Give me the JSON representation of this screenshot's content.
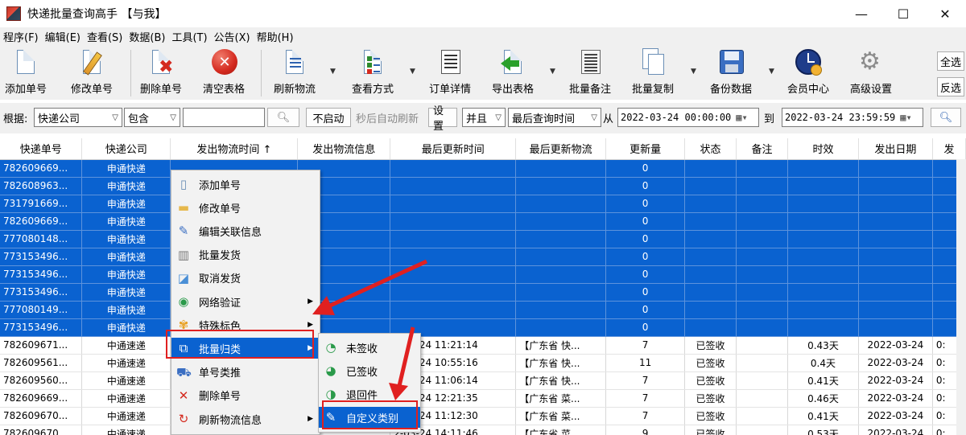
{
  "window": {
    "title": "快递批量查询高手 【与我】",
    "controls": [
      "—",
      "☐",
      "✕"
    ]
  },
  "menu": [
    "程序(F)",
    "编辑(E)",
    "查看(S)",
    "数据(B)",
    "工具(T)",
    "公告(X)",
    "帮助(H)"
  ],
  "toolbar": {
    "buttons": [
      {
        "label": "添加单号",
        "icon": "add-document-icon"
      },
      {
        "label": "修改单号",
        "icon": "edit-pencil-icon"
      },
      {
        "label": "删除单号",
        "icon": "delete-document-icon"
      },
      {
        "label": "清空表格",
        "icon": "clear-red-x-icon"
      },
      {
        "label": "刷新物流",
        "icon": "refresh-document-icon"
      },
      {
        "label": "查看方式",
        "icon": "checklist-icon"
      },
      {
        "label": "订单详情",
        "icon": "order-detail-icon"
      },
      {
        "label": "导出表格",
        "icon": "export-arrow-icon"
      },
      {
        "label": "批量备注",
        "icon": "notes-icon"
      },
      {
        "label": "批量复制",
        "icon": "copy-documents-icon"
      },
      {
        "label": "备份数据",
        "icon": "floppy-disk-icon"
      },
      {
        "label": "会员中心",
        "icon": "clock-member-icon"
      },
      {
        "label": "高级设置",
        "icon": "gear-icon"
      }
    ],
    "select_all": "全选",
    "invert_select": "反选"
  },
  "filter": {
    "basis_label": "根据:",
    "field": "快递公司",
    "operator": "包含",
    "keyword": "",
    "no_start": "不启动",
    "auto_refresh_hint": "秒后自动刷新",
    "settings": "设置",
    "logic": "并且",
    "time_field": "最后查询时间",
    "from_label": "从",
    "from": "2022-03-24 00:00:00",
    "to_label": "到",
    "to": "2022-03-24 23:59:59"
  },
  "table": {
    "columns": [
      "快递单号",
      "快递公司",
      "发出物流时间 ↑",
      "发出物流信息",
      "最后更新时间",
      "最后更新物流",
      "更新量",
      "状态",
      "备注",
      "时效",
      "发出日期",
      "发"
    ],
    "rows": [
      [
        "782609669...",
        "申通快递",
        "",
        "",
        "",
        "",
        "0",
        "",
        "",
        "",
        "",
        ""
      ],
      [
        "782608963...",
        "申通快递",
        "",
        "",
        "",
        "",
        "0",
        "",
        "",
        "",
        "",
        ""
      ],
      [
        "731791669...",
        "申通快递",
        "",
        "",
        "",
        "",
        "0",
        "",
        "",
        "",
        "",
        ""
      ],
      [
        "782609669...",
        "申通快递",
        "",
        "",
        "",
        "",
        "0",
        "",
        "",
        "",
        "",
        ""
      ],
      [
        "777080148...",
        "申通快递",
        "",
        "",
        "",
        "",
        "0",
        "",
        "",
        "",
        "",
        ""
      ],
      [
        "773153496...",
        "申通快递",
        "",
        "",
        "",
        "",
        "0",
        "",
        "",
        "",
        "",
        ""
      ],
      [
        "773153496...",
        "申通快递",
        "",
        "",
        "",
        "",
        "0",
        "",
        "",
        "",
        "",
        ""
      ],
      [
        "773153496...",
        "申通快递",
        "",
        "",
        "",
        "",
        "0",
        "",
        "",
        "",
        "",
        ""
      ],
      [
        "777080149...",
        "申通快递",
        "",
        "",
        "",
        "",
        "0",
        "",
        "",
        "",
        "",
        ""
      ],
      [
        "773153496...",
        "申通快递",
        "",
        "",
        "",
        "",
        "0",
        "",
        "",
        "",
        "",
        ""
      ],
      [
        "782609671...",
        "中通速递",
        "",
        "",
        "2-03-24 11:21:14",
        "【广东省 快...",
        "7",
        "已签收",
        "",
        "0.43天",
        "2022-03-24",
        "0:"
      ],
      [
        "782609561...",
        "中通速递",
        "",
        "",
        "2-03-24 10:55:16",
        "【广东省 快...",
        "11",
        "已签收",
        "",
        "0.4天",
        "2022-03-24",
        "0:"
      ],
      [
        "782609560...",
        "中通速递",
        "",
        "",
        "2-03-24 11:06:14",
        "【广东省 快...",
        "7",
        "已签收",
        "",
        "0.41天",
        "2022-03-24",
        "0:"
      ],
      [
        "782609669...",
        "中通速递",
        "",
        "",
        "2-03-24 12:21:35",
        "【广东省 菜...",
        "7",
        "已签收",
        "",
        "0.46天",
        "2022-03-24",
        "0:"
      ],
      [
        "782609670...",
        "中通速递",
        "",
        "",
        "2-03-24 11:12:30",
        "【广东省 菜...",
        "7",
        "已签收",
        "",
        "0.41天",
        "2022-03-24",
        "0:"
      ],
      [
        "782609670...",
        "中通速递",
        "",
        "",
        "2-03-24 14:11:46",
        "【广东省 菜...",
        "9",
        "已签收",
        "",
        "0.53天",
        "2022-03-24",
        "0:"
      ]
    ],
    "selected_count": 10
  },
  "context_menu": {
    "items": [
      {
        "label": "添加单号",
        "icon": "add-document-icon"
      },
      {
        "label": "修改单号",
        "icon": "folder-icon"
      },
      {
        "label": "编辑关联信息",
        "icon": "edit-link-icon"
      },
      {
        "label": "批量发货",
        "icon": "ship-icon"
      },
      {
        "label": "取消发货",
        "icon": "cancel-ship-icon"
      },
      {
        "label": "网络验证",
        "icon": "globe-icon",
        "submenu": true
      },
      {
        "label": "特殊标色",
        "icon": "color-flower-icon",
        "submenu": true
      },
      {
        "label": "批量归类",
        "icon": "classify-icon",
        "submenu": true
      },
      {
        "label": "单号类推",
        "icon": "truck-icon"
      },
      {
        "label": "删除单号",
        "icon": "delete-x-icon"
      },
      {
        "label": "刷新物流信息",
        "icon": "refresh-icon",
        "submenu": true
      }
    ],
    "highlighted": "批量归类"
  },
  "submenu": {
    "items": [
      {
        "label": "未签收",
        "icon": "unsigned-icon"
      },
      {
        "label": "已签收",
        "icon": "signed-icon"
      },
      {
        "label": "退回件",
        "icon": "returned-icon"
      },
      {
        "label": "自定义类别",
        "icon": "custom-category-icon"
      }
    ],
    "highlighted": "自定义类别"
  },
  "colors": {
    "selection": "#0a62d0",
    "annotation": "#e02020",
    "toolbar_bg": "#f0f0f0"
  }
}
